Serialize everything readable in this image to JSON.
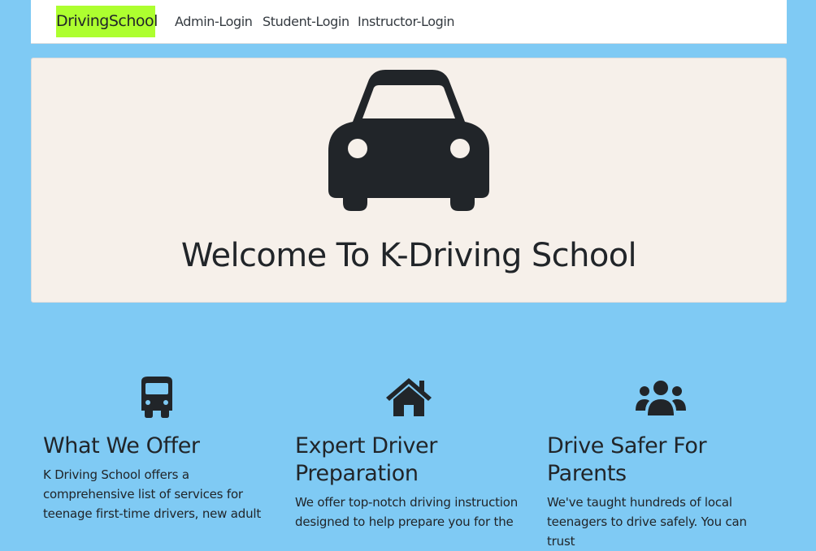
{
  "navbar": {
    "brand": "DrivingSchool",
    "links": [
      "Admin-Login",
      "Student-Login",
      "Instructor-Login"
    ],
    "brand_color": "#adff2f"
  },
  "hero": {
    "icon": "car-icon",
    "title": "Welcome To K-Driving School",
    "background": "#f6f0ea"
  },
  "features": [
    {
      "icon": "bus-icon",
      "title": "What We Offer",
      "text": "K Driving School offers a comprehensive list of services for teenage first-time drivers, new adult"
    },
    {
      "icon": "house-icon",
      "title": "Expert Driver Preparation",
      "text": "We offer top-notch driving instruction designed to help prepare you for the"
    },
    {
      "icon": "users-icon",
      "title": "Drive Safer For Parents",
      "text": "We've taught hundreds of local teenagers to drive safely. You can trust"
    }
  ],
  "page_background": "#7fcaf4"
}
